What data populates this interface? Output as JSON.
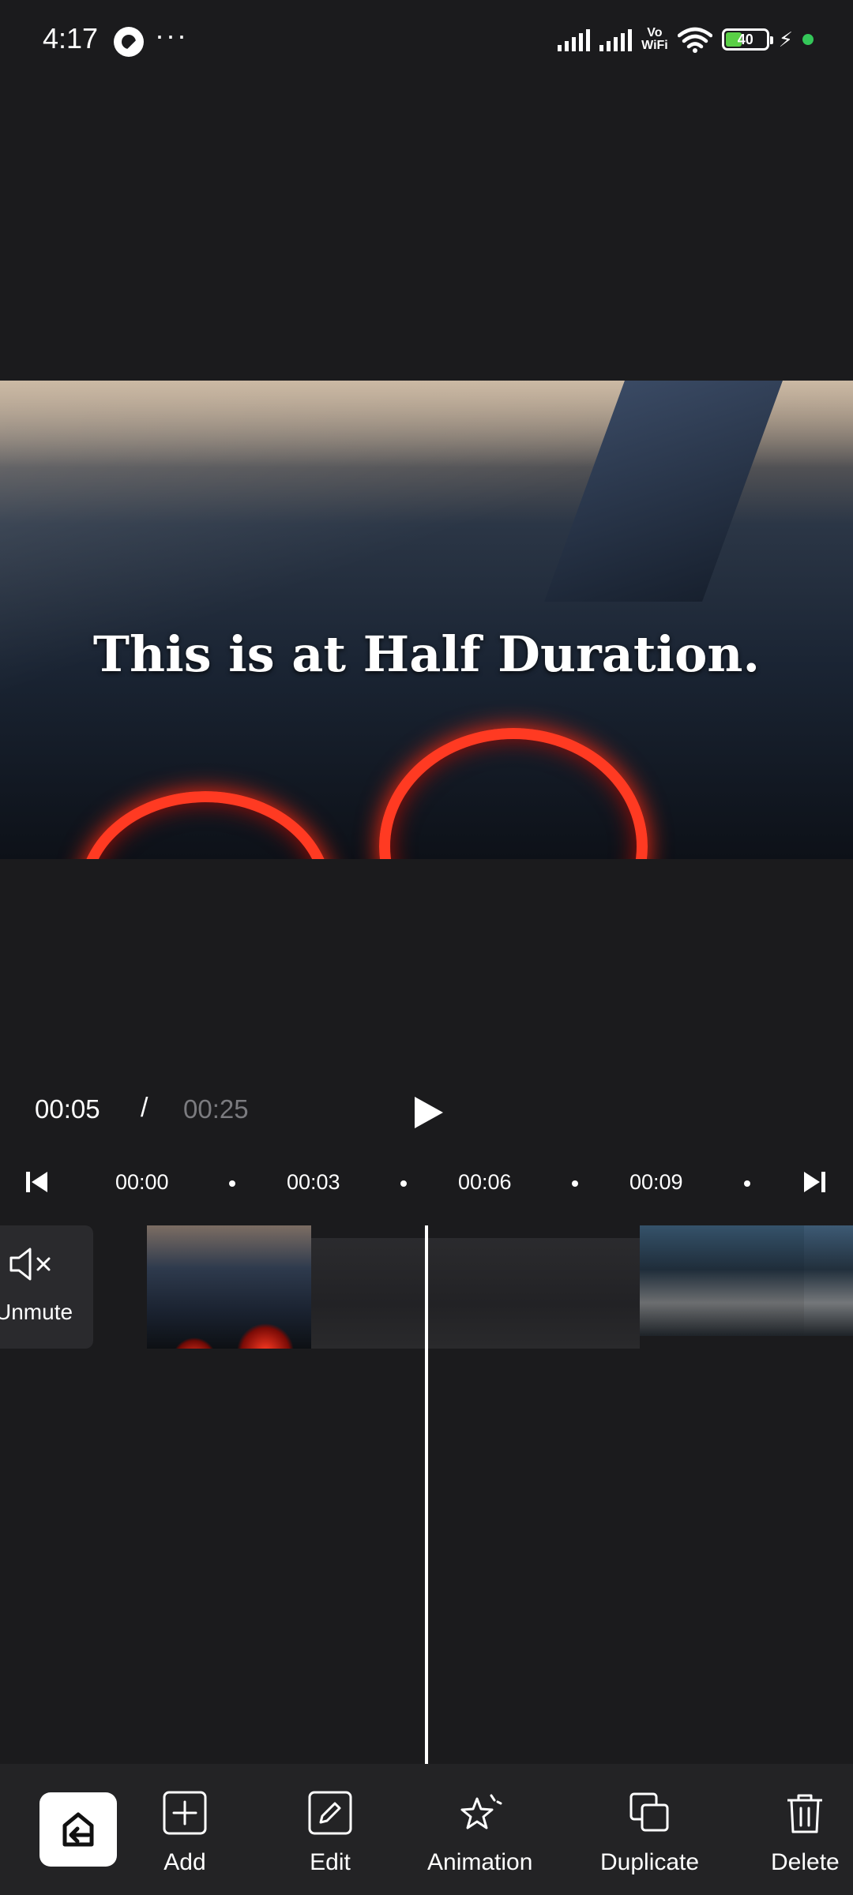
{
  "status_bar": {
    "time": "4:17",
    "more": "···",
    "network_label": "Vo\nWiFi",
    "battery_level": "40",
    "charging": "⚡"
  },
  "preview": {
    "caption": "This is at Half Duration."
  },
  "playback": {
    "current_time": "00:05",
    "separator": "/",
    "total_time": "00:25"
  },
  "ruler": {
    "ticks": [
      "00:00",
      "00:03",
      "00:06",
      "00:09"
    ]
  },
  "track": {
    "unmute_label": "Unmute"
  },
  "toolbar": {
    "add_label": "Add",
    "edit_label": "Edit",
    "animation_label": "Animation",
    "duplicate_label": "Duplicate",
    "delete_label": "Delete"
  },
  "colors": {
    "background": "#1b1b1d",
    "toolbar": "#232325",
    "muted_text": "#7b7b7f",
    "battery_fill": "#5ad046",
    "status_dot": "#34c759"
  }
}
